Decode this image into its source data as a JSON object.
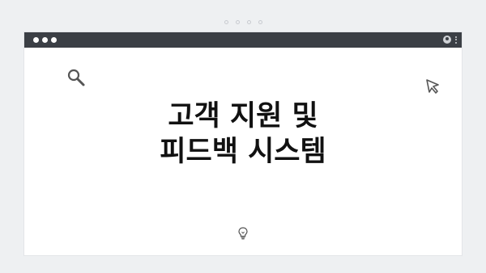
{
  "window": {
    "title_lines": [
      "고객 지원 및",
      "피드백 시스템"
    ]
  },
  "icons": {
    "titlebar_left": "window-controls",
    "titlebar_user": "user-icon",
    "titlebar_menu": "kebab-menu-icon",
    "decor_top_left": "search-icon",
    "decor_top_right": "cursor-icon",
    "decor_bottom": "lightbulb-icon"
  },
  "colors": {
    "background": "#eef0f2",
    "titlebar": "#3b3f45",
    "window": "#ffffff",
    "text": "#111111"
  }
}
